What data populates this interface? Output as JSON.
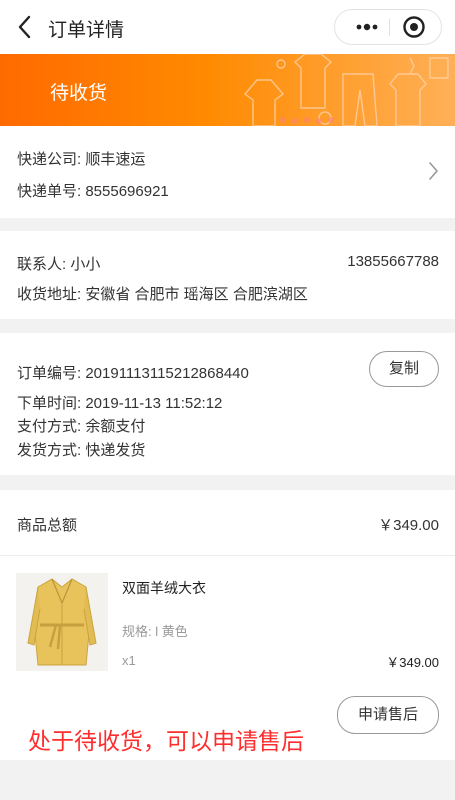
{
  "nav": {
    "title": "订单详情"
  },
  "banner": {
    "status": "待收货"
  },
  "express": {
    "company": "快递公司: 顺丰速运",
    "tracking": "快递单号: 8555696921"
  },
  "address": {
    "contact": "联系人: 小小",
    "phone": "13855667788",
    "address": "收货地址: 安徽省 合肥市 瑶海区 合肥滨湖区"
  },
  "order": {
    "number": "订单编号: 20191113115212868440",
    "copy_label": "复制",
    "time": "下单时间: 2019-11-13 11:52:12",
    "payment": "支付方式: 余额支付",
    "shipping": "发货方式: 快递发货"
  },
  "total": {
    "label": "商品总额",
    "value": "￥349.00"
  },
  "product": {
    "name": "双面羊绒大衣",
    "spec": "规格: l 黄色",
    "qty": "x1",
    "price": "￥349.00",
    "after_sale_label": "申请售后"
  },
  "note": "处于待收货，可以申请售后"
}
